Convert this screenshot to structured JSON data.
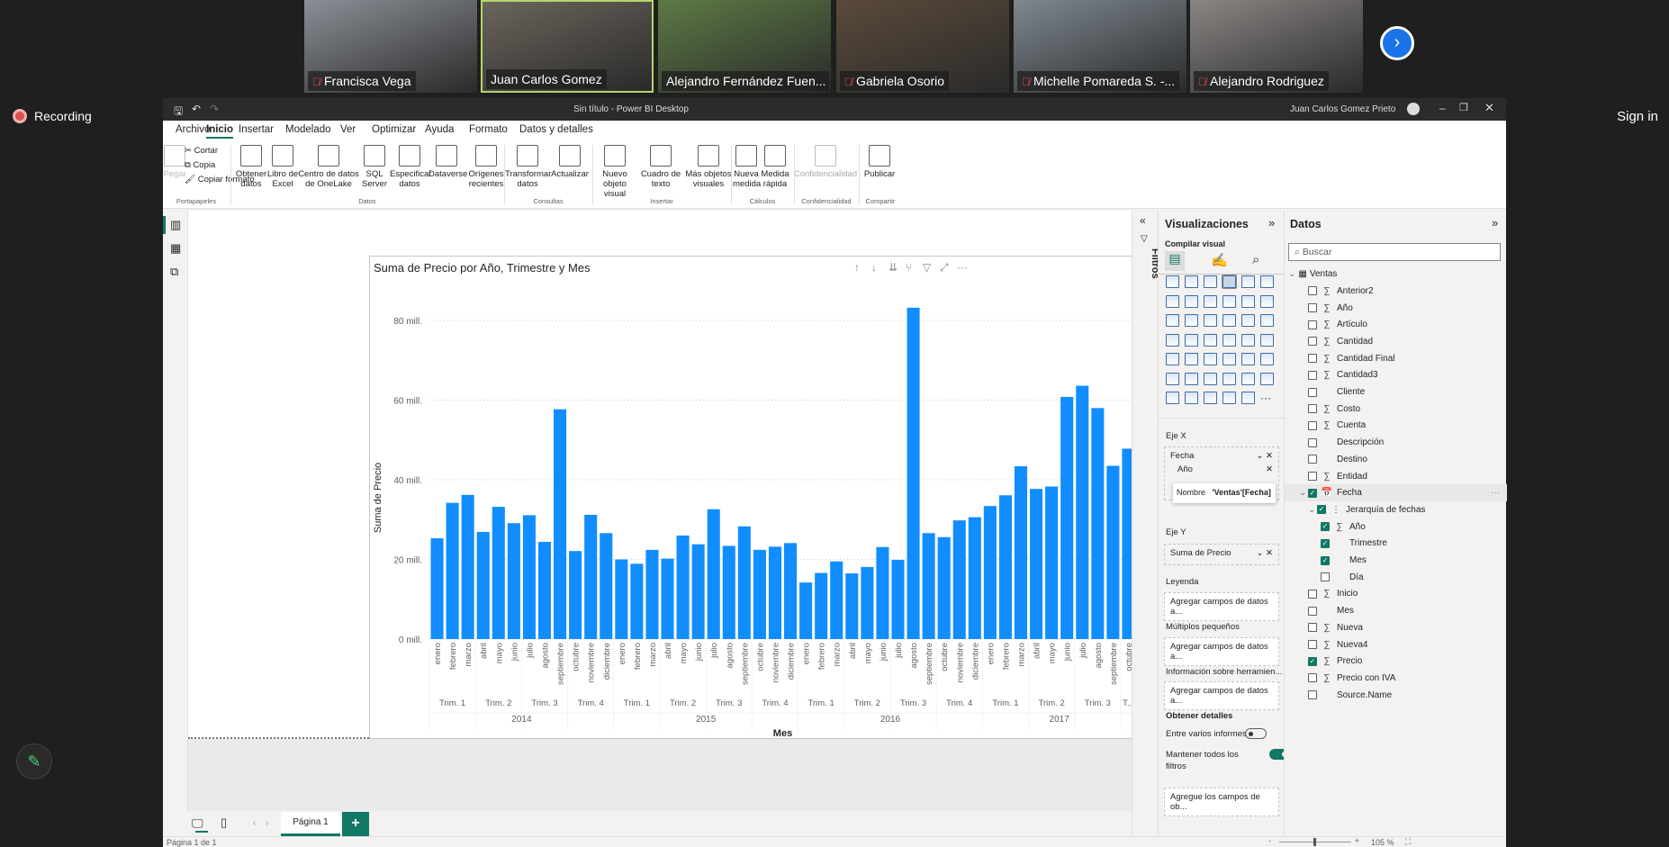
{
  "meeting": {
    "participants": [
      {
        "name": "Francisca Vega",
        "muted": true
      },
      {
        "name": "Juan Carlos Gomez",
        "muted": false
      },
      {
        "name": "Alejandro Fernández Fuen...",
        "muted": false
      },
      {
        "name": "Gabriela Osorio",
        "muted": true
      },
      {
        "name": "Michelle Pomareda S. -...",
        "muted": true
      },
      {
        "name": "Alejandro Rodriguez",
        "muted": true
      }
    ],
    "recording_label": "Recording",
    "sign_in": "Sign in",
    "next_icon": "chevron-right"
  },
  "window": {
    "title": "Sin título - Power BI Desktop",
    "user": "Juan Carlos Gomez Prieto"
  },
  "menu_tabs": [
    "Archivo",
    "Inicio",
    "Insertar",
    "Modelado",
    "Ver",
    "Optimizar",
    "Ayuda",
    "Formato",
    "Datos y detalles"
  ],
  "active_tab": "Inicio",
  "ribbon": {
    "buttons": [
      "Pegar",
      "Cortar",
      "Copia",
      "Copiar formato",
      "Obtener datos",
      "Libro de Excel",
      "Centro de datos de OneLake",
      "SQL Server",
      "Especificar datos",
      "Dataverse",
      "Orígenes recientes",
      "Transformar datos",
      "Actualizar",
      "Nuevo objeto visual",
      "Cuadro de texto",
      "Más objetos visuales",
      "Nueva medida",
      "Medida rápida",
      "Confidencialidad",
      "Publicar"
    ],
    "groups": [
      "Portapapeles",
      "Datos",
      "Consultas",
      "Insertar",
      "Cálculos",
      "Confidencialidad",
      "Compartir"
    ]
  },
  "pages": {
    "tabs": [
      "Página 1"
    ],
    "status": "Página 1 de 1",
    "zoom": "105 %"
  },
  "filters_label": "Filtros",
  "visualizations": {
    "title": "Visualizaciones",
    "subtitle": "Compilar visual",
    "wells": {
      "x_label": "Eje X",
      "x_fields": [
        "Fecha",
        "Año"
      ],
      "tooltip_name": "Nombre",
      "tooltip_value": "'Ventas'[Fecha]",
      "y_label": "Eje Y",
      "y_field": "Suma de Precio",
      "legend_label": "Leyenda",
      "legend_placeholder": "Agregar campos de datos a...",
      "small_label": "Múltiplos pequeños",
      "small_placeholder": "Agregar campos de datos a...",
      "tooltips_label": "Información sobre herramien...",
      "tooltips_placeholder": "Agregar campos de datos a...",
      "drill_label": "Obtener detalles",
      "cross_report": "Entre varios informes",
      "cross_report_on": false,
      "keep_filters": "Mantener todos los filtros",
      "keep_filters_on": true,
      "drill_placeholder": "Agregue los campos de ob..."
    }
  },
  "datos": {
    "title": "Datos",
    "search_placeholder": "Buscar",
    "table": "Ventas",
    "fields": [
      {
        "name": "Anterior2",
        "sigma": true,
        "checked": false,
        "level": 0
      },
      {
        "name": "Año",
        "sigma": true,
        "checked": false,
        "level": 0
      },
      {
        "name": "Artículo",
        "sigma": true,
        "checked": false,
        "level": 0
      },
      {
        "name": "Cantidad",
        "sigma": true,
        "checked": false,
        "level": 0
      },
      {
        "name": "Cantidad Final",
        "sigma": true,
        "checked": false,
        "level": 0
      },
      {
        "name": "Cantidad3",
        "sigma": true,
        "checked": false,
        "level": 0
      },
      {
        "name": "Cliente",
        "sigma": false,
        "checked": false,
        "level": 0
      },
      {
        "name": "Costo",
        "sigma": true,
        "checked": false,
        "level": 0
      },
      {
        "name": "Cuenta",
        "sigma": true,
        "checked": false,
        "level": 0
      },
      {
        "name": "Descripción",
        "sigma": false,
        "checked": false,
        "level": 0
      },
      {
        "name": "Destino",
        "sigma": false,
        "checked": false,
        "level": 0
      },
      {
        "name": "Entidad",
        "sigma": true,
        "checked": false,
        "level": 0
      },
      {
        "name": "Fecha",
        "sigma": false,
        "checked": true,
        "level": 0,
        "expand": true
      },
      {
        "name": "Jerarquía de fechas",
        "sigma": false,
        "checked": true,
        "level": 1,
        "expand": true
      },
      {
        "name": "Año",
        "sigma": true,
        "checked": true,
        "level": 2
      },
      {
        "name": "Trimestre",
        "sigma": false,
        "checked": true,
        "level": 2
      },
      {
        "name": "Mes",
        "sigma": false,
        "checked": true,
        "level": 2
      },
      {
        "name": "Día",
        "sigma": false,
        "checked": false,
        "level": 2
      },
      {
        "name": "Inicio",
        "sigma": true,
        "checked": false,
        "level": 0
      },
      {
        "name": "Mes",
        "sigma": false,
        "checked": false,
        "level": 0
      },
      {
        "name": "Nueva",
        "sigma": true,
        "checked": false,
        "level": 0
      },
      {
        "name": "Nueva4",
        "sigma": true,
        "checked": false,
        "level": 0
      },
      {
        "name": "Precio",
        "sigma": true,
        "checked": true,
        "level": 0
      },
      {
        "name": "Precio con IVA",
        "sigma": true,
        "checked": false,
        "level": 0
      },
      {
        "name": "Source.Name",
        "sigma": false,
        "checked": false,
        "level": 0
      }
    ]
  },
  "chart_data": {
    "type": "bar",
    "title": "Suma de Precio por Año, Trimestre y Mes",
    "xlabel": "Mes",
    "ylabel": "Suma de Precio",
    "ylim": [
      0,
      88
    ],
    "yticks": [
      0,
      20,
      40,
      60,
      80
    ],
    "ytick_labels": [
      "0 mill.",
      "20 mill.",
      "40 mill.",
      "60 mill.",
      "80 mill."
    ],
    "grid": true,
    "color": "#118dff",
    "years": [
      {
        "label": "2014",
        "months": 12
      },
      {
        "label": "2015",
        "months": 12
      },
      {
        "label": "2016",
        "months": 12
      },
      {
        "label": "2017",
        "months": 10
      }
    ],
    "quarter_labels": [
      "Trim. 1",
      "Trim. 2",
      "Trim. 3",
      "Trim. 4"
    ],
    "truncated_quarter_label": "T...",
    "categories": [
      "enero",
      "febrero",
      "marzo",
      "abril",
      "mayo",
      "junio",
      "julio",
      "agosto",
      "septiembre",
      "octubre",
      "noviembre",
      "diciembre",
      "enero",
      "febrero",
      "marzo",
      "abril",
      "mayo",
      "junio",
      "julio",
      "agosto",
      "septiembre",
      "octubre",
      "noviembre",
      "diciembre",
      "enero",
      "febrero",
      "marzo",
      "abril",
      "mayo",
      "junio",
      "julio",
      "agosto",
      "septiembre",
      "octubre",
      "noviembre",
      "diciembre",
      "enero",
      "febrero",
      "marzo",
      "abril",
      "mayo",
      "junio",
      "julio",
      "agosto",
      "septiembre",
      "octubre"
    ],
    "values": [
      25.3,
      34.2,
      36.2,
      26.9,
      33.2,
      29.1,
      31.1,
      24.4,
      57.7,
      22.1,
      31.2,
      26.6,
      20.0,
      18.9,
      22.4,
      20.2,
      26.0,
      23.8,
      32.6,
      23.4,
      28.3,
      22.4,
      23.2,
      24.1,
      14.2,
      16.6,
      19.5,
      16.5,
      18.1,
      23.1,
      19.9,
      83.2,
      26.6,
      25.6,
      29.8,
      30.6,
      33.4,
      36.1,
      43.4,
      37.7,
      38.3,
      60.8,
      63.6,
      58.0,
      43.5,
      47.8
    ],
    "unit": "millones"
  }
}
